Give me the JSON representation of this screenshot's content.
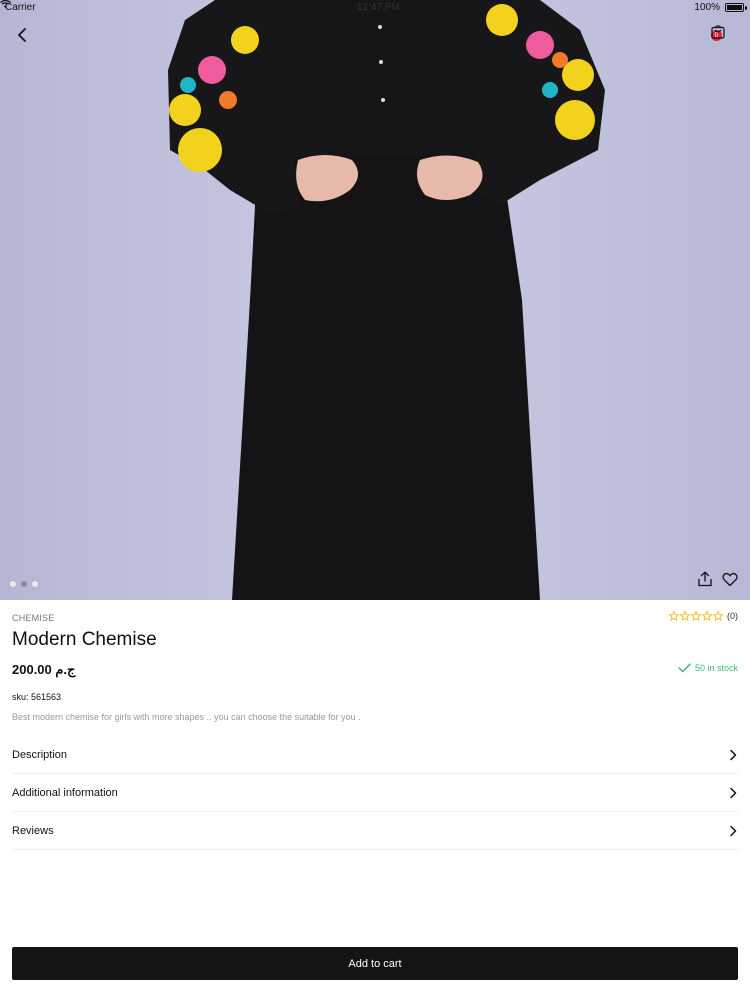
{
  "status_bar": {
    "carrier": "Carrier",
    "time": "12:47 PM",
    "battery": "100%"
  },
  "header": {
    "cart_count": "0",
    "back_icon": "chevron-left-icon",
    "cart_icon": "shopping-bag-icon"
  },
  "gallery": {
    "image_count": 3,
    "active_index": 1,
    "share_icon": "share-icon",
    "favorite_icon": "heart-icon"
  },
  "product": {
    "category": "CHEMISE",
    "rating_value": 0,
    "rating_count": "(0)",
    "name": "Modern Chemise",
    "price": "200.00 ج.م",
    "stock": "50 in stock",
    "sku_label": "sku:",
    "sku_value": "561563",
    "short_description": "Best modern chemise for girls with more shapes .. you can choose the suitable for you ."
  },
  "sections": [
    {
      "label": "Description"
    },
    {
      "label": "Additional information"
    },
    {
      "label": "Reviews"
    }
  ],
  "actions": {
    "add_to_cart": "Add to cart"
  },
  "colors": {
    "accent": "#141414",
    "badge": "#e2202f",
    "stock": "#3cb878",
    "star": "#f0b400"
  }
}
